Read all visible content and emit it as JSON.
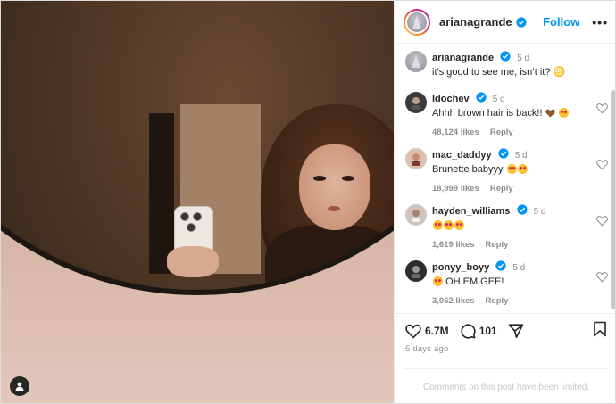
{
  "header": {
    "username": "arianagrande",
    "follow_label": "Follow",
    "more_label": "•••"
  },
  "caption": {
    "username": "arianagrande",
    "time": "5 d",
    "text": "it’s good to see me, isn’t it? ♋"
  },
  "comments": [
    {
      "username": "ldochev",
      "time": "5 d",
      "text": "Ahhh brown hair is back!!",
      "likes": "48,124 likes",
      "reply": "Reply"
    },
    {
      "username": "mac_daddyy",
      "time": "5 d",
      "text": "Brunette babyyy",
      "likes": "18,999 likes",
      "reply": "Reply"
    },
    {
      "username": "hayden_williams",
      "time": "5 d",
      "text": "",
      "likes": "1,619 likes",
      "reply": "Reply"
    },
    {
      "username": "ponyy_boyy",
      "time": "5 d",
      "text": "OH EM GEE!",
      "likes": "3,062 likes",
      "reply": "Reply"
    }
  ],
  "actions": {
    "likes_count": "6.7M",
    "comments_count": "101",
    "posted": "5 days ago"
  },
  "footer": {
    "text": "Comments on this post have been limited."
  },
  "colors": {
    "accent": "#0095f6",
    "verified": "#0095f6",
    "muted": "#8e8e8e"
  }
}
